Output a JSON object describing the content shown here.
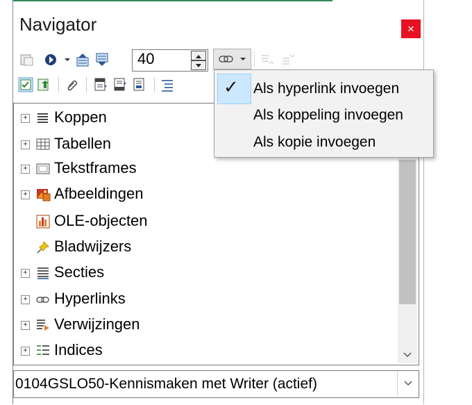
{
  "window": {
    "title": "Navigator",
    "close_glyph": "×"
  },
  "toolbar": {
    "row1": [
      "toggle-icon",
      "navigation-target-icon",
      "chevron-down-icon",
      "previous-object-icon",
      "next-object-icon"
    ],
    "spin_value": "40",
    "insert_mode_icon": "chain-link-icon",
    "row2": [
      "content-view-icon",
      "toggle-content-icon",
      "attachment-icon",
      "header-icon",
      "footer-icon",
      "anchor-icon",
      "heading-level-icon"
    ]
  },
  "tree": {
    "items": [
      {
        "label": "Koppen",
        "icon": "headings-icon",
        "expandable": true
      },
      {
        "label": "Tabellen",
        "icon": "table-icon",
        "expandable": true
      },
      {
        "label": "Tekstframes",
        "icon": "frame-icon",
        "expandable": true
      },
      {
        "label": "Afbeeldingen",
        "icon": "image-icon",
        "expandable": true
      },
      {
        "label": "OLE-objecten",
        "icon": "ole-chart-icon",
        "expandable": false
      },
      {
        "label": "Bladwijzers",
        "icon": "bookmark-pin-icon",
        "expandable": false
      },
      {
        "label": "Secties",
        "icon": "sections-icon",
        "expandable": true
      },
      {
        "label": "Hyperlinks",
        "icon": "hyperlink-icon",
        "expandable": true
      },
      {
        "label": "Verwijzingen",
        "icon": "references-icon",
        "expandable": true
      },
      {
        "label": "Indices",
        "icon": "indices-icon",
        "expandable": true
      }
    ],
    "expand_glyph": "+"
  },
  "document_select": {
    "value": "0104GSLO50-Kennismaken met Writer (actief)"
  },
  "dropdown_menu": {
    "items": [
      {
        "label": "Als hyperlink invoegen",
        "checked": true
      },
      {
        "label": "Als koppeling invoegen",
        "checked": false
      },
      {
        "label": "Als kopie invoegen",
        "checked": false
      }
    ],
    "check_glyph": "✓"
  }
}
